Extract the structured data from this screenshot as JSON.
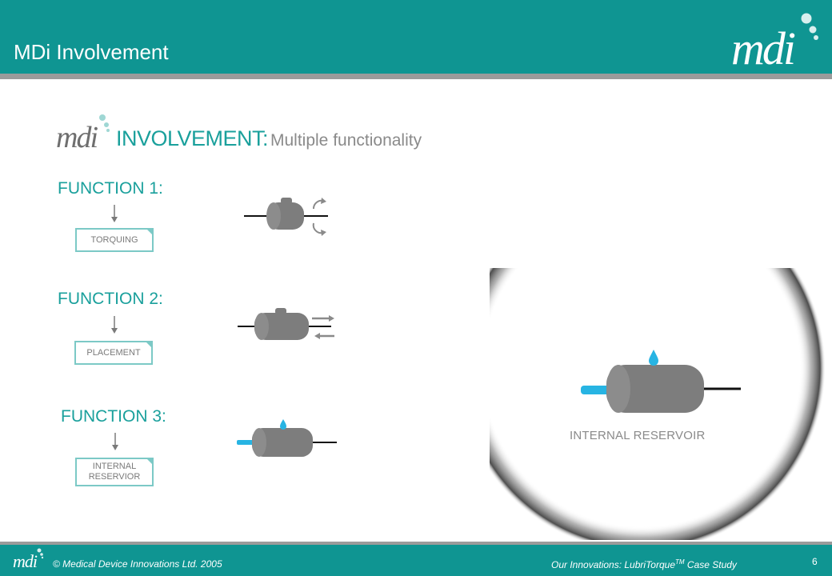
{
  "header": {
    "title": "MDi Involvement",
    "logo_text": "mdi",
    "background_color": "#0f9592"
  },
  "content": {
    "logo_text": "mdi",
    "heading_bold": "INVOLVEMENT:",
    "heading_sub": "Multiple functionality",
    "functions": [
      {
        "label": "FUNCTION 1:",
        "box": "TORQUING",
        "icon": "torquing-cylinder-icon"
      },
      {
        "label": "FUNCTION 2:",
        "box": "PLACEMENT",
        "icon": "placement-cylinder-icon"
      },
      {
        "label": "FUNCTION 3:",
        "box": "INTERNAL\nRESERVIOR",
        "icon": "reservoir-cylinder-icon"
      }
    ],
    "reservoir_caption": "INTERNAL RESERVOIR",
    "accent_color": "#1aa09c",
    "fluid_color": "#27b4e3"
  },
  "footer": {
    "logo_text": "mdi",
    "copyright": "© Medical Device Innovations Ltd. 2005",
    "case_study_prefix": "Our Innovations: LubriTorque",
    "case_study_tm": "TM",
    "case_study_suffix": " Case Study",
    "page_number": "6"
  }
}
